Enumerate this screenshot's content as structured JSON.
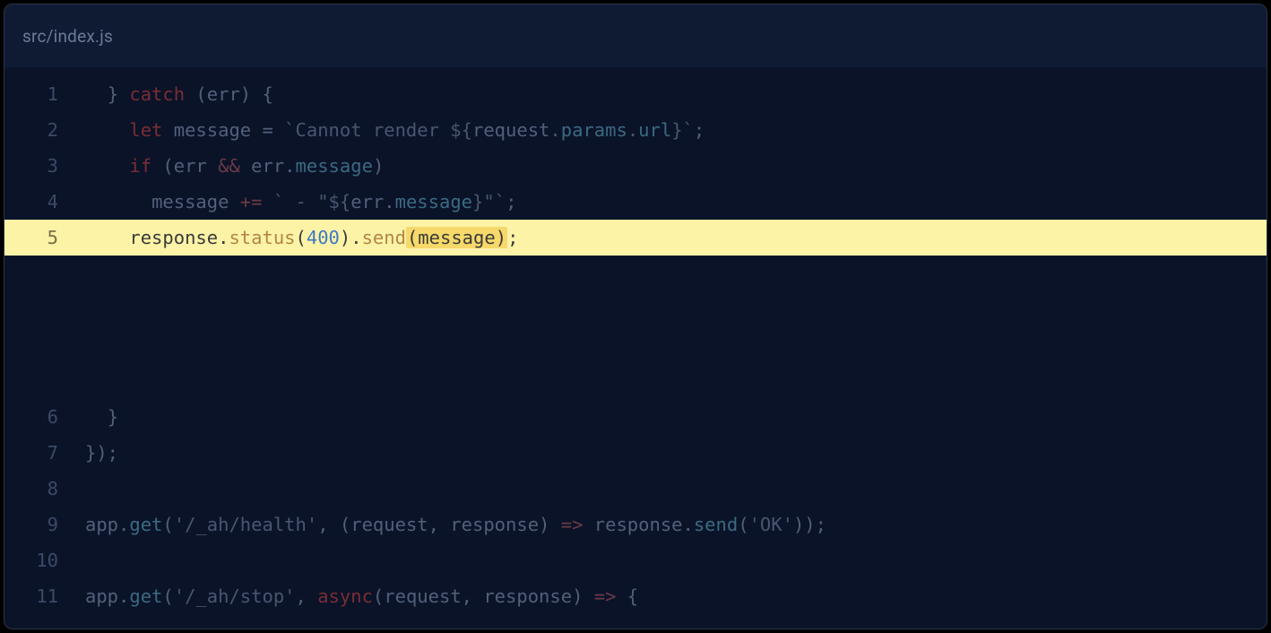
{
  "file": {
    "path": "src/index.js"
  },
  "code": {
    "lines": [
      {
        "n": "1",
        "indent": "  ",
        "tokens": [
          [
            "plain",
            "} "
          ],
          [
            "kw",
            "catch"
          ],
          [
            "plain",
            " (err) {"
          ]
        ]
      },
      {
        "n": "2",
        "indent": "    ",
        "tokens": [
          [
            "kw",
            "let"
          ],
          [
            "plain",
            " message = "
          ],
          [
            "str",
            "`Cannot render ${"
          ],
          [
            "plain",
            "request"
          ],
          [
            "str",
            "."
          ],
          [
            "prop",
            "params"
          ],
          [
            "str",
            "."
          ],
          [
            "prop",
            "url"
          ],
          [
            "str",
            "}`"
          ],
          [
            "plain",
            ";"
          ]
        ]
      },
      {
        "n": "3",
        "indent": "    ",
        "tokens": [
          [
            "kw",
            "if"
          ],
          [
            "plain",
            " (err "
          ],
          [
            "op",
            "&&"
          ],
          [
            "plain",
            " err."
          ],
          [
            "prop",
            "message"
          ],
          [
            "plain",
            ")"
          ]
        ]
      },
      {
        "n": "4",
        "indent": "      ",
        "tokens": [
          [
            "plain",
            "message "
          ],
          [
            "op",
            "+="
          ],
          [
            "plain",
            " "
          ],
          [
            "str",
            "` - \"${"
          ],
          [
            "plain",
            "err."
          ],
          [
            "prop",
            "message"
          ],
          [
            "str",
            "}\"`"
          ],
          [
            "plain",
            ";"
          ]
        ]
      },
      {
        "n": "5",
        "indent": "    ",
        "highlighted": true,
        "tokens": [
          [
            "plain",
            "response."
          ],
          [
            "call",
            "status"
          ],
          [
            "plain",
            "("
          ],
          [
            "num",
            "400"
          ],
          [
            "plain",
            ")."
          ],
          [
            "call",
            "send"
          ],
          [
            "ih",
            "(message)"
          ],
          [
            "plain",
            ";"
          ]
        ]
      },
      {
        "gap": true
      },
      {
        "n": "6",
        "indent": "  ",
        "tokens": [
          [
            "plain",
            "}"
          ]
        ]
      },
      {
        "n": "7",
        "indent": "",
        "tokens": [
          [
            "plain",
            "});"
          ]
        ]
      },
      {
        "n": "8",
        "indent": "",
        "tokens": []
      },
      {
        "n": "9",
        "indent": "",
        "tokens": [
          [
            "plain",
            "app."
          ],
          [
            "call",
            "get"
          ],
          [
            "plain",
            "("
          ],
          [
            "str",
            "'/_ah/health'"
          ],
          [
            "plain",
            ", (request, response) "
          ],
          [
            "arrow",
            "=>"
          ],
          [
            "plain",
            " response."
          ],
          [
            "call",
            "send"
          ],
          [
            "plain",
            "("
          ],
          [
            "str",
            "'OK'"
          ],
          [
            "plain",
            "));"
          ]
        ]
      },
      {
        "n": "10",
        "indent": "",
        "tokens": []
      },
      {
        "n": "11",
        "indent": "",
        "tokens": [
          [
            "plain",
            "app."
          ],
          [
            "call",
            "get"
          ],
          [
            "plain",
            "("
          ],
          [
            "str",
            "'/_ah/stop'"
          ],
          [
            "plain",
            ", "
          ],
          [
            "kw",
            "async"
          ],
          [
            "plain",
            "(request, response) "
          ],
          [
            "arrow",
            "=>"
          ],
          [
            "plain",
            " {"
          ]
        ]
      }
    ]
  }
}
